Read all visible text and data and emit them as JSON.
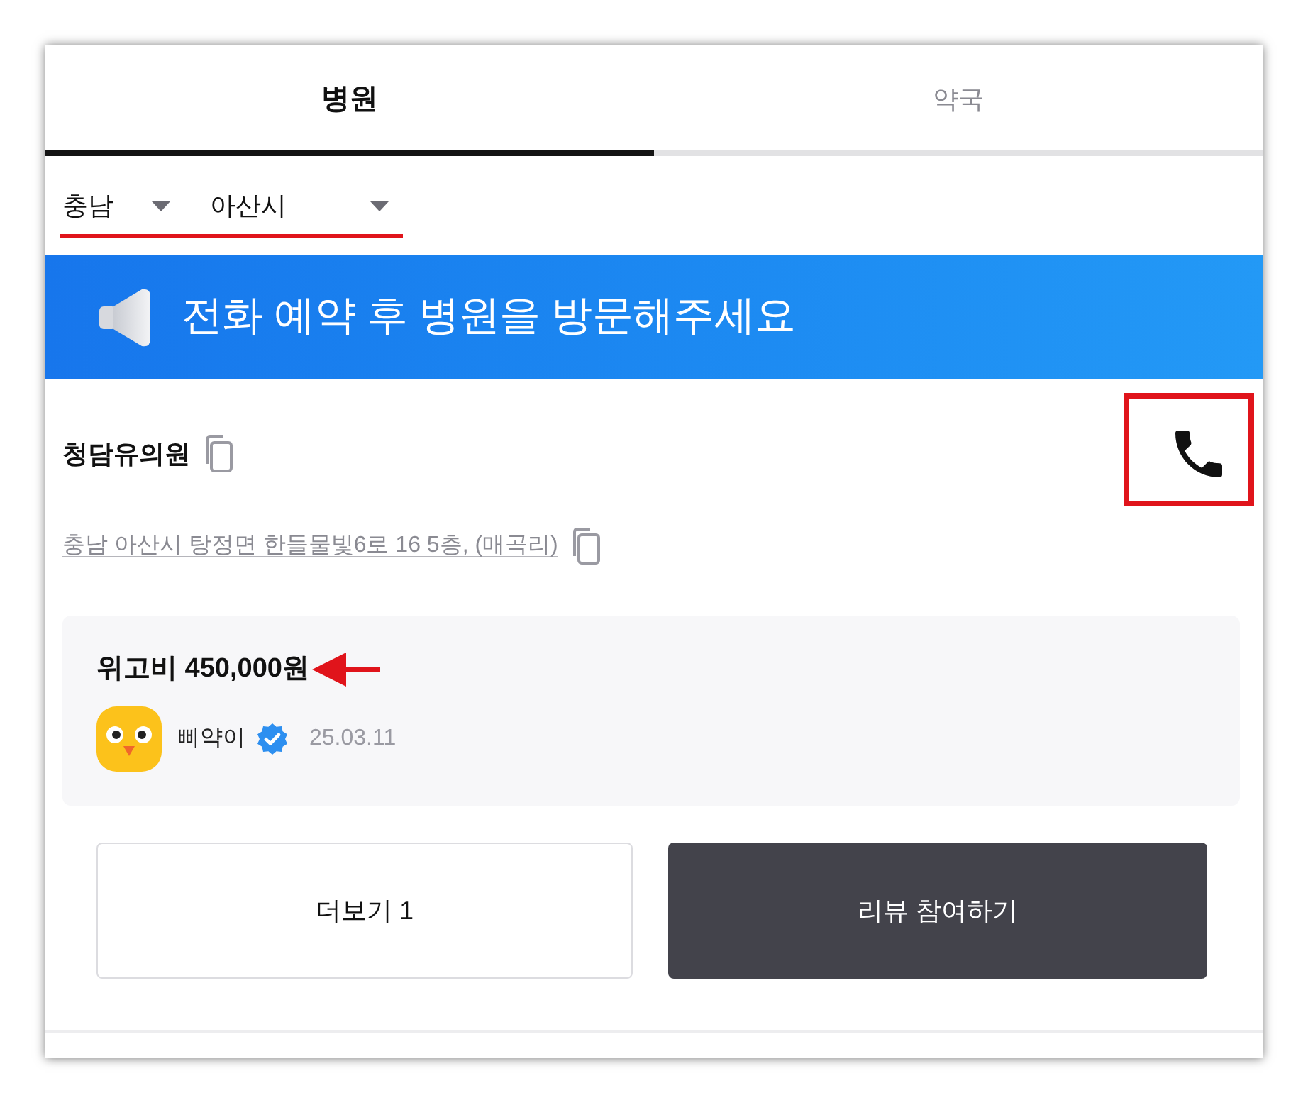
{
  "tabs": [
    {
      "label": "병원",
      "selected": true
    },
    {
      "label": "약국",
      "selected": false
    }
  ],
  "region_filter": {
    "annotated": true,
    "dropdowns": [
      {
        "value": "충남"
      },
      {
        "value": "아산시"
      }
    ]
  },
  "banner": {
    "text": "전화 예약 후 병원을 방문해주세요"
  },
  "hospital": {
    "name": "청담유의원",
    "address": "충남 아산시 탕정면 한들물빛6로 16 5층, (매곡리)",
    "call_button": {
      "annotated": true
    }
  },
  "review": {
    "title": "위고비 450,000원",
    "annotated": true,
    "author": "삐약이",
    "verified": true,
    "date": "25.03.11"
  },
  "buttons": [
    {
      "label": "더보기 1",
      "kind": "outline"
    },
    {
      "label": "리뷰 참여하기",
      "kind": "filled"
    }
  ]
}
